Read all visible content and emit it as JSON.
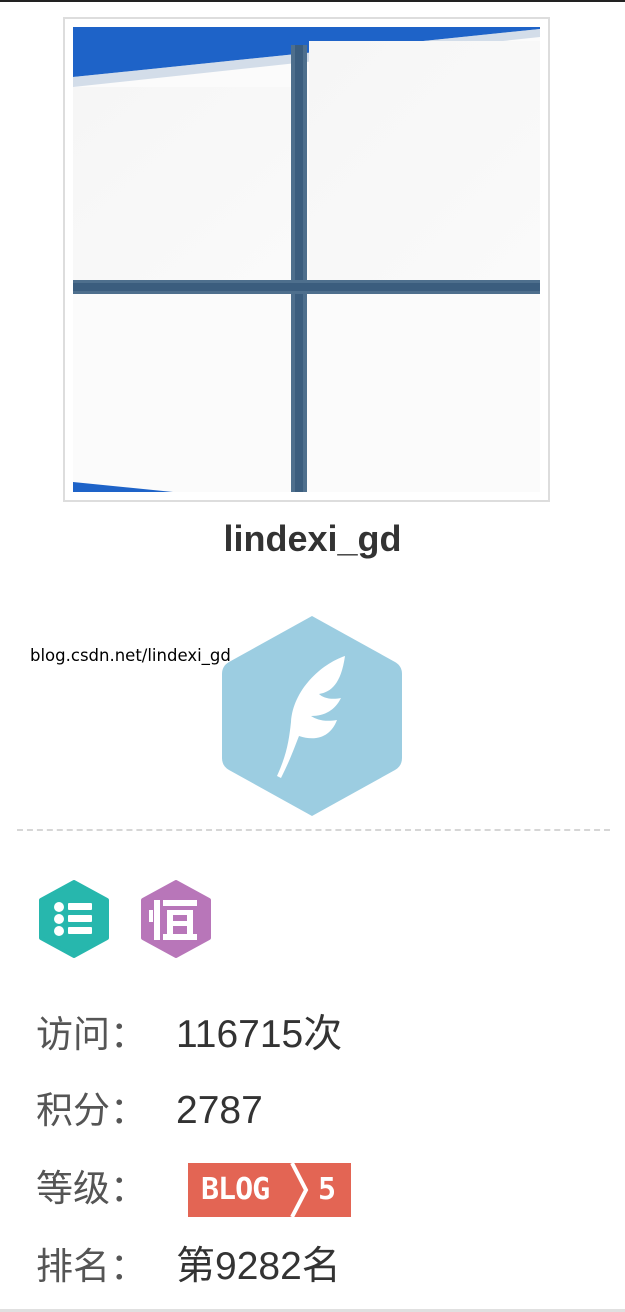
{
  "profile": {
    "avatar_icon": "windows-logo-closeup-avatar",
    "username": "lindexi_gd",
    "blog_url": "blog.csdn.net/lindexi_gd",
    "level_icon": "feather-hexagon-icon"
  },
  "badges": [
    {
      "icon": "list-icon",
      "color": "#27b7ad"
    },
    {
      "icon": "heng-icon",
      "color": "#b876b9"
    }
  ],
  "stats": {
    "visits": {
      "label": "访问：",
      "value": "116715次"
    },
    "points": {
      "label": "积分：",
      "value": "2787"
    },
    "level": {
      "label": "等级：",
      "badge_text": "BLOG",
      "badge_level": "5",
      "badge_color": "#e36554"
    },
    "rank": {
      "label": "排名：",
      "value": "第9282名"
    }
  }
}
